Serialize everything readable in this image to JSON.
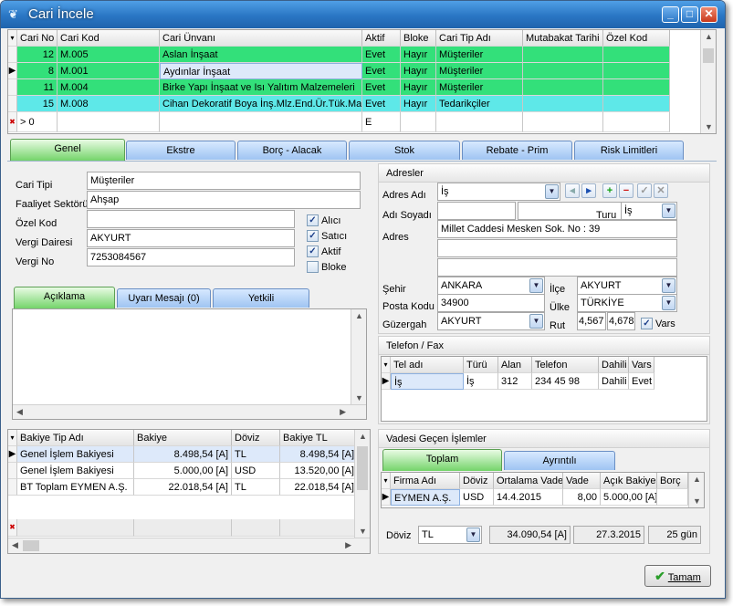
{
  "window": {
    "title": "Cari İncele",
    "min_label": "_",
    "max_label": "□",
    "close_label": "✕"
  },
  "top_grid": {
    "columns": [
      "Cari No",
      "Cari Kod",
      "Cari Ünvanı",
      "Aktif",
      "Bloke",
      "Cari Tip Adı",
      "Mutabakat Tarihi",
      "Özel Kod"
    ],
    "rows": [
      {
        "no": "12",
        "kod": "M.005",
        "unvan": "Aslan İnşaat",
        "aktif": "Evet",
        "bloke": "Hayır",
        "tip": "Müşteriler",
        "color": "#33e07a"
      },
      {
        "no": "8",
        "kod": "M.001",
        "unvan": "Aydınlar İnşaat",
        "aktif": "Evet",
        "bloke": "Hayır",
        "tip": "Müşteriler",
        "color": "#33e07a"
      },
      {
        "no": "11",
        "kod": "M.004",
        "unvan": "Birke Yapı İnşaat ve Isı Yalıtım Malzemeleri",
        "aktif": "Evet",
        "bloke": "Hayır",
        "tip": "Müşteriler",
        "color": "#33e07a"
      },
      {
        "no": "15",
        "kod": "M.008",
        "unvan": "Cihan Dekoratif Boya İnş.Mlz.End.Ür.Tük.Mal.",
        "aktif": "Evet",
        "bloke": "Hayır",
        "tip": "Tedarikçiler",
        "color": "#5ee8e8"
      }
    ],
    "filter_no": "> 0",
    "filter_aktif": "E"
  },
  "main_tabs": [
    "Genel",
    "Ekstre",
    "Borç - Alacak",
    "Stok",
    "Rebate - Prim",
    "Risk Limitleri"
  ],
  "genel": {
    "cari_tipi_label": "Cari Tipi",
    "cari_tipi": "Müşteriler",
    "faaliyet_label": "Faaliyet Sektörü",
    "faaliyet": "Ahşap",
    "ozel_kod_label": "Özel Kod",
    "ozel_kod": "",
    "vergi_dairesi_label": "Vergi Dairesi",
    "vergi_dairesi": "AKYURT",
    "vergi_no_label": "Vergi No",
    "vergi_no": "7253084567",
    "checks": [
      {
        "label": "Alıcı",
        "checked": true
      },
      {
        "label": "Satıcı",
        "checked": true
      },
      {
        "label": "Aktif",
        "checked": true
      },
      {
        "label": "Bloke",
        "checked": false
      }
    ]
  },
  "sub_tabs": [
    "Açıklama",
    "Uyarı Mesajı (0)",
    "Yetkili"
  ],
  "adresler": {
    "title": "Adresler",
    "adres_adi_label": "Adres Adı",
    "adres_adi": "İş",
    "adi_soyadi_label": "Adı Soyadı",
    "turu_label": "Turu",
    "turu": "İş",
    "adres_label": "Adres",
    "adres1": "Millet Caddesi Mesken Sok. No : 39",
    "sehir_label": "Şehir",
    "sehir": "ANKARA",
    "ilce_label": "İlçe",
    "ilce": "AKYURT",
    "posta_kodu_label": "Posta Kodu",
    "posta_kodu": "34900",
    "ulke_label": "Ülke",
    "ulke": "TÜRKİYE",
    "guzergah_label": "Güzergah",
    "guzergah": "AKYURT",
    "rut_label": "Rut",
    "rut1": "4,567",
    "rut2": "4,678",
    "vars_label": "Vars"
  },
  "telefon": {
    "title": "Telefon / Fax",
    "columns": [
      "Tel adı",
      "Türü",
      "Alan",
      "Telefon",
      "Dahili",
      "Vars"
    ],
    "rows": [
      {
        "ad": "İş",
        "tur": "İş",
        "alan": "312",
        "tel": "234 45 98",
        "dahili": "Dahili",
        "vars": "Evet"
      }
    ]
  },
  "bakiye": {
    "columns": [
      "Bakiye Tip Adı",
      "Bakiye",
      "Döviz",
      "Bakiye TL"
    ],
    "rows": [
      {
        "ad": "Genel İşlem Bakiyesi",
        "bakiye": "8.498,54 [A]",
        "doviz": "TL",
        "tl": "8.498,54 [A]"
      },
      {
        "ad": "Genel İşlem Bakiyesi",
        "bakiye": "5.000,00 [A]",
        "doviz": "USD",
        "tl": "13.520,00 [A]"
      },
      {
        "ad": "BT Toplam EYMEN A.Ş.",
        "bakiye": "22.018,54 [A]",
        "doviz": "TL",
        "tl": "22.018,54 [A]"
      }
    ]
  },
  "vadesi": {
    "title": "Vadesi Geçen İşlemler",
    "tabs": [
      "Toplam",
      "Ayrıntılı"
    ],
    "columns": [
      "Firma Adı",
      "Döviz",
      "Ortalama Vade",
      "Vade",
      "Açık Bakiye",
      "Borç"
    ],
    "rows": [
      {
        "firma": "EYMEN A.Ş.",
        "doviz": "USD",
        "ort": "14.4.2015",
        "vade": "8,00",
        "acik": "5.000,00 [A]"
      }
    ],
    "doviz_label": "Döviz",
    "doviz": "TL",
    "toplam": "34.090,54 [A]",
    "tarih": "27.3.2015",
    "gun": "25 gün"
  },
  "tamam_label": "Tamam",
  "colors": {
    "green_row": "#33e07a",
    "cyan_row": "#5ee8e8",
    "tab_blue": "#9fc4f2",
    "tab_green": "#74d46a"
  }
}
